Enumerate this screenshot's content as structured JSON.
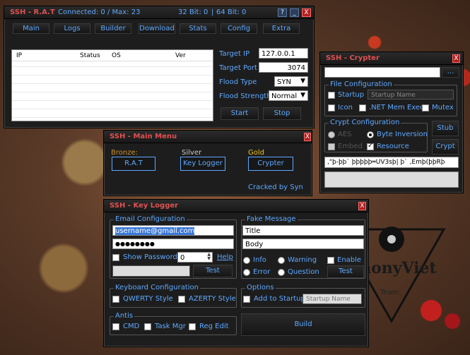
{
  "rat": {
    "title": "SSH - R.A.T",
    "connected": "Connected: 0 / Max: 23",
    "bits32": "32 Bit: 0",
    "bits64": "64 Bit: 0",
    "help": "?",
    "minimize": "_",
    "close": "X",
    "tabs": [
      "Main",
      "Logs",
      "Builder",
      "Download",
      "Stats",
      "Config",
      "Extra"
    ],
    "columns": [
      "IP",
      "Status",
      "OS",
      "Ver"
    ],
    "target_ip_label": "Target IP",
    "target_ip": "127.0.0.1",
    "target_port_label": "Target Port",
    "target_port": "3074",
    "flood_type_label": "Flood Type",
    "flood_type": "SYN",
    "flood_strength_label": "Flood Strength",
    "flood_strength": "Normal",
    "start": "Start",
    "stop": "Stop"
  },
  "menu": {
    "title": "SSH - Main Menu",
    "close": "X",
    "bronze": "Bronze:",
    "silver": "Silver",
    "gold": "Gold",
    "rat_btn": "R.A.T",
    "keylogger_btn": "Key Logger",
    "crypter_btn": "Crypter",
    "cracked": "Cracked by Syn",
    "bronze_color": "#c8902a",
    "gold_color": "#e8c020"
  },
  "crypter": {
    "title": "SSH - Crypter",
    "close": "X",
    "browse": "...",
    "file_config": "File Configuration",
    "startup": "Startup",
    "startup_name_placeholder": "Startup Name",
    "icon": "Icon",
    "net_mem": ".NET Mem Exec",
    "mutex": "Mutex",
    "crypt_config": "Crypt Configuration",
    "aes": "AES",
    "byte_inversion": "Byte Inversion",
    "embed": "Embed",
    "resource": "Resource",
    "stub": "Stub",
    "crypt": "Crypt",
    "key": ",\"þ-þþ` þþþþþ═UV3sþ|  þ` ,Emþ(þþRþ"
  },
  "keylogger": {
    "title": "SSH - Key Logger",
    "close": "X",
    "email_config": "Email Configuration",
    "email": "username@gmail.com",
    "password": "●●●●●●●●",
    "show_password": "Show Password",
    "interval": "0",
    "help_link": "Help",
    "test": "Test",
    "fake_message": "Fake Message",
    "fm_title": "Title",
    "fm_body": "Body",
    "info": "Info",
    "warning": "Warning",
    "enable": "Enable",
    "error": "Error",
    "question": "Question",
    "test2": "Test",
    "keyboard_config": "Keyboard Configuration",
    "qwerty": "QWERTY Style",
    "azerty": "AZERTY Style",
    "options": "Options",
    "add_startup": "Add to Startup",
    "startup_name_placeholder": "Startup Name",
    "antis": "Antis",
    "cmd": "CMD",
    "task_mgr": "Task Mgr",
    "reg_edit": "Reg Edit",
    "build": "Build"
  },
  "watermark": {
    "brand": "AnonyViet",
    "team": "Team"
  }
}
